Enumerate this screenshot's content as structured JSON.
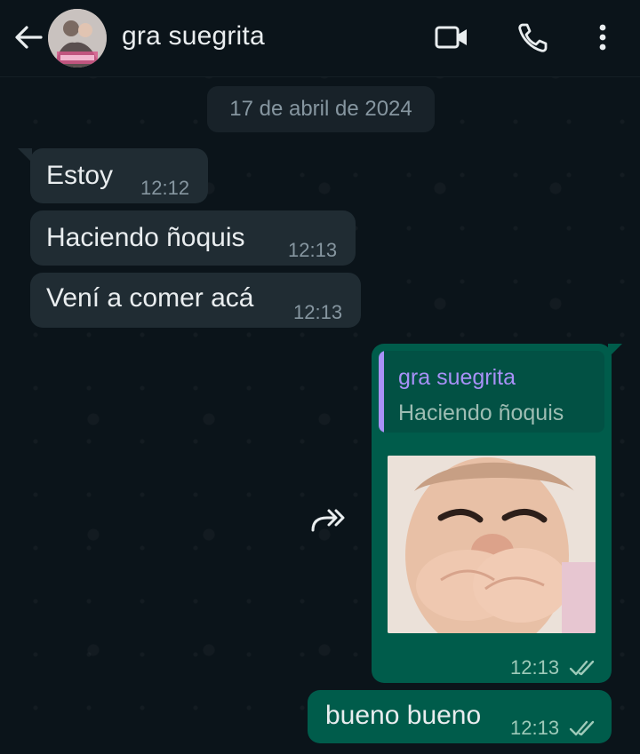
{
  "header": {
    "contact_name": "gra suegrita"
  },
  "chat": {
    "date_separator": "17 de abril de 2024",
    "incoming": [
      {
        "text": "Estoy",
        "time": "12:12"
      },
      {
        "text": "Haciendo ñoquis",
        "time": "12:13"
      },
      {
        "text": "Vení a comer acá",
        "time": "12:13"
      }
    ],
    "outgoing_reply": {
      "quoted_author": "gra suegrita",
      "quoted_text": "Haciendo ñoquis",
      "media": "photo of a smiling child covering mouth",
      "time": "12:13",
      "status": "read"
    },
    "outgoing_text": {
      "text": "bueno bueno",
      "time": "12:13",
      "status": "read"
    }
  },
  "colors": {
    "background": "#0b141a",
    "incoming_bubble": "#202c33",
    "outgoing_bubble": "#005c4b",
    "quote_accent": "#a891f7",
    "read_tick": "#9ecab9"
  },
  "icons": [
    "back-arrow-icon",
    "video-call-icon",
    "phone-icon",
    "more-options-icon",
    "forward-icon",
    "double-check-icon"
  ]
}
